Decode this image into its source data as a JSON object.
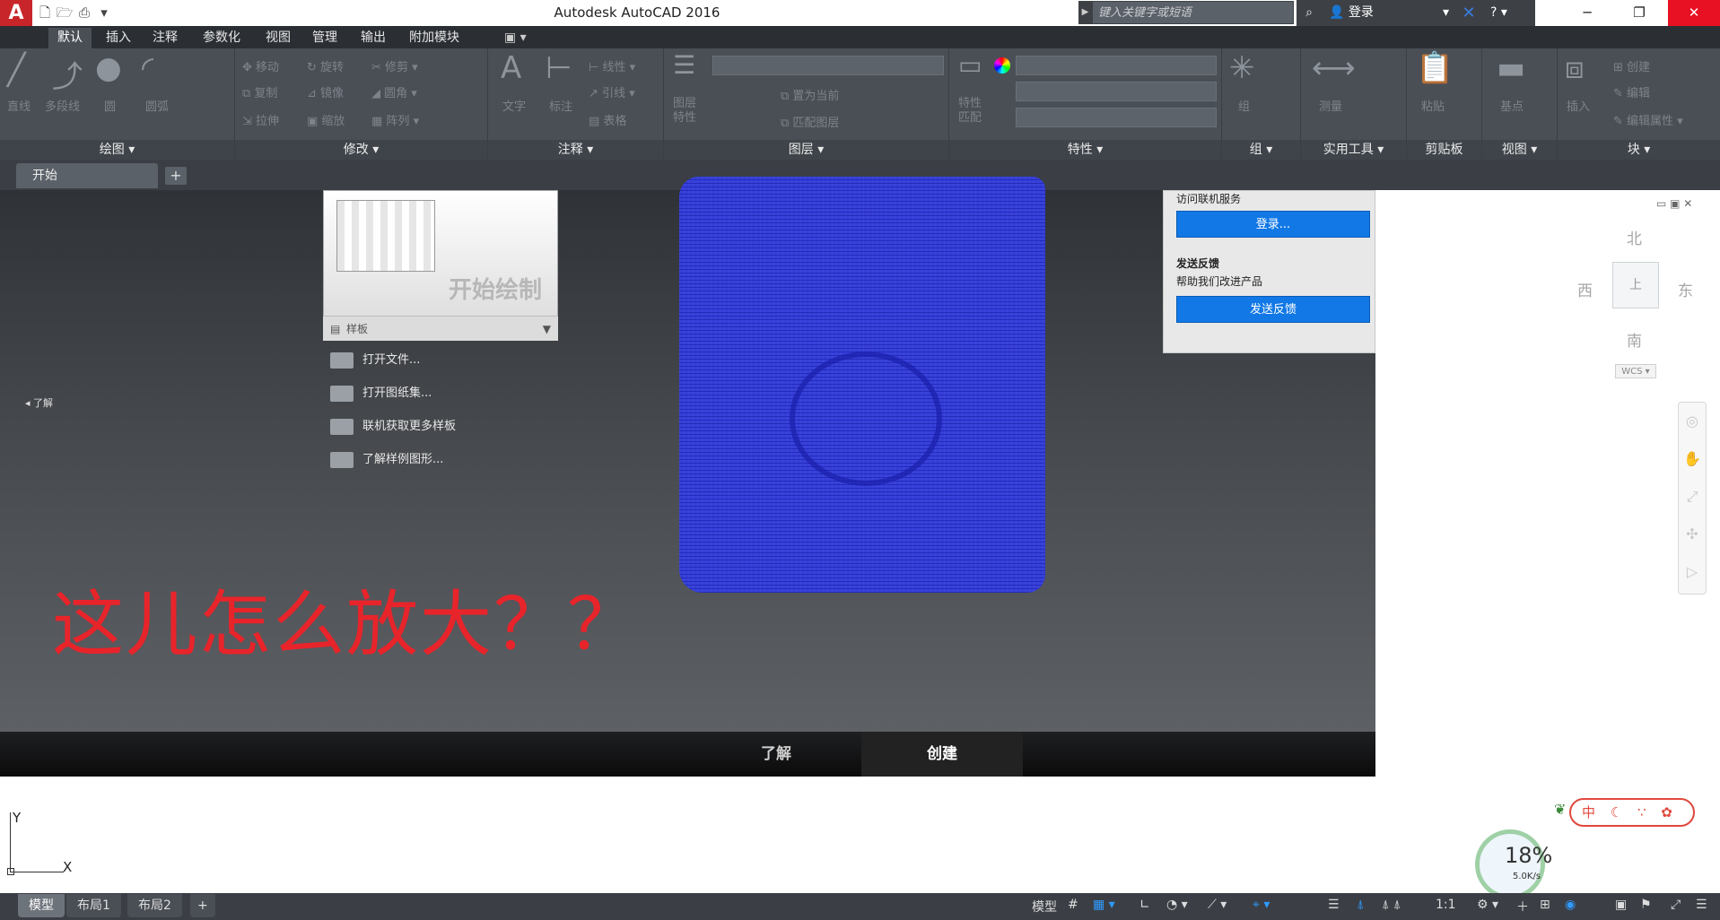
{
  "titlebar": {
    "app_title": "Autodesk AutoCAD 2016",
    "search_placeholder": "键入关键字或短语",
    "login": "登录",
    "help": "?"
  },
  "ribbon_tabs": [
    "默认",
    "插入",
    "注释",
    "参数化",
    "视图",
    "管理",
    "输出",
    "附加模块"
  ],
  "panels": {
    "draw": {
      "title": "绘图",
      "tools": [
        "直线",
        "多段线",
        "圆",
        "圆弧"
      ]
    },
    "modify": {
      "title": "修改",
      "tools": [
        "移动",
        "旋转",
        "修剪",
        "复制",
        "镜像",
        "圆角",
        "拉伸",
        "缩放",
        "阵列"
      ]
    },
    "annotation": {
      "title": "注释",
      "tools": [
        "文字",
        "标注",
        "线性",
        "引线",
        "表格"
      ]
    },
    "layers": {
      "title": "图层",
      "tools": [
        "图层特性",
        "置为当前",
        "匹配图层"
      ]
    },
    "properties": {
      "title": "特性",
      "tools": [
        "特性匹配"
      ]
    },
    "groups": {
      "title": "组",
      "tools": [
        "组"
      ]
    },
    "utilities": {
      "title": "实用工具",
      "tools": [
        "测量"
      ]
    },
    "clipboard": {
      "title": "剪贴板",
      "tools": [
        "粘贴"
      ]
    },
    "view": {
      "title": "视图",
      "tools": [
        "基点"
      ]
    },
    "block": {
      "title": "块",
      "tools": [
        "插入",
        "创建",
        "编辑",
        "编辑属性"
      ]
    }
  },
  "doc_tab": "开始",
  "start_page": {
    "learn_side": "◂  了解",
    "template_card_title": "开始绘制",
    "template_label": "样板",
    "links": [
      "打开文件...",
      "打开图纸集...",
      "联机获取更多样板",
      "了解样例图形..."
    ],
    "bottom_tabs": [
      "了解",
      "创建"
    ],
    "annotation_text": "这儿怎么放大？？"
  },
  "online_panel": {
    "top_text": "访问联机服务",
    "login_btn": "登录...",
    "feedback_title": "发送反馈",
    "feedback_desc": "帮助我们改进产品",
    "feedback_btn": "发送反馈"
  },
  "viewcube": {
    "north": "北",
    "south": "南",
    "east": "东",
    "west": "西",
    "face": "上",
    "wcs": "WCS"
  },
  "ucs": {
    "y": "Y",
    "x": "X"
  },
  "network": {
    "percent": "18%",
    "speed": "5.0K/s"
  },
  "badge_icons": "中 ☾ ∵ ✿",
  "layout_tabs": [
    "模型",
    "布局1",
    "布局2"
  ],
  "status": {
    "model": "模型",
    "scale": "1:1"
  },
  "colors": {
    "blue_blob": "#3640d8",
    "annotation_red": "#e8242b",
    "button_blue": "#1178e6"
  }
}
